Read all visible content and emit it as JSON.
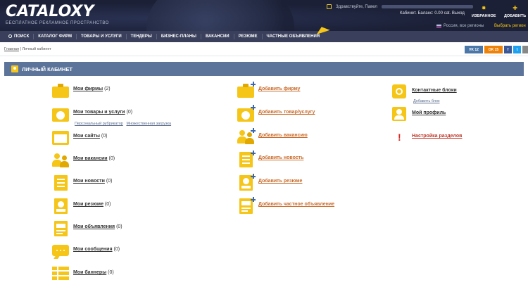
{
  "header": {
    "logo": "CATALOXY",
    "tagline": "БЕСПЛАТНОЕ РЕКЛАМНОЕ ПРОСТРАНСТВО",
    "greeting": "Здравствуйте, Павел",
    "account_line": "Кабинет. Баланс: 0.00 cat. Выход",
    "favorites_label": "ИЗБРАННОЕ",
    "add_label": "ДОБАВИТЬ",
    "region": "Россия, все регионы",
    "region_button": "Выбрать регион"
  },
  "nav": {
    "items": [
      "ПОИСК",
      "КАТАЛОГ ФИРМ",
      "ТОВАРЫ И УСЛУГИ",
      "ТЕНДЕРЫ",
      "БИЗНЕС-ПЛАНЫ",
      "ВАКАНСИИ",
      "РЕЗЮМЕ",
      "ЧАСТНЫЕ ОБЪЯВЛЕНИЯ"
    ]
  },
  "breadcrumb": {
    "home": "Главная",
    "separator": "|",
    "current": "Личный кабинет"
  },
  "share": {
    "vk_count": "12",
    "ok_count": "15"
  },
  "panel": {
    "title": "ЛИЧНЫЙ КАБИНЕТ"
  },
  "col1": [
    {
      "label": "Мои фирмы",
      "count": "(2)"
    },
    {
      "label": "Мои товары и услуги",
      "count": "(0)"
    },
    {
      "label": "Мои сайты",
      "count": "(0)"
    },
    {
      "label": "Мои вакансии",
      "count": "(0)"
    },
    {
      "label": "Мои новости",
      "count": "(0)"
    },
    {
      "label": "Мои резюме",
      "count": "(0)"
    },
    {
      "label": "Мои объявления",
      "count": "(0)"
    },
    {
      "label": "Мои сообщения",
      "count": "(0)"
    },
    {
      "label": "Мои баннеры",
      "count": "(0)"
    }
  ],
  "col1_sub": {
    "rubricator": "Персональный рубрикатор",
    "upload": "Множественная загрузка"
  },
  "col2": [
    {
      "label": "Добавить фирму"
    },
    {
      "label": "Добавить товар/услугу"
    },
    {
      "label": "Добавить вакансию"
    },
    {
      "label": "Добавить новость"
    },
    {
      "label": "Добавить резюме"
    },
    {
      "label": "Добавить частное объявление"
    }
  ],
  "col3": [
    {
      "label": "Контактные блоки"
    },
    {
      "label": "Мой профиль"
    },
    {
      "label": "Настройка разделов"
    }
  ],
  "col3_sub": {
    "add_block": "Добавить блок"
  }
}
